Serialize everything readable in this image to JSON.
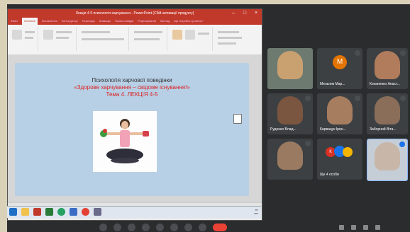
{
  "ppt": {
    "window_title": "Лекція 4-5 психологія харчування - PowerPoint (Сбій активації продукту)",
    "tabs": [
      "Файл",
      "Основне",
      "Вставлення",
      "Конструктор",
      "Переходи",
      "Анімація",
      "Показ слайдів",
      "Рецензування",
      "Вигляд",
      "Що потрібно зробити?"
    ],
    "slide": {
      "line1": "Психологія харчової поведінки",
      "line2": "«Здорове харчування – свідоме існування!»",
      "line3": "Тема 4. ЛЕКЦІЯ 4-5"
    }
  },
  "participants": [
    {
      "name": "",
      "face_color": "#c9a070",
      "bg": "#6d7a70"
    },
    {
      "name": "Мельник Мар...",
      "avatar_letter": "М",
      "avatar_color": "#e37400"
    },
    {
      "name": "Коханенко Анаст...",
      "face_color": "#b07c5c",
      "bg": "#8a8a88"
    },
    {
      "name": "Руденко Влад...",
      "face_color": "#7a5540",
      "bg": "#5a4c40"
    },
    {
      "name": "Карвацук Ірин...",
      "face_color": "#a77d60",
      "bg": "#8a6d56"
    },
    {
      "name": "Заборний Віта...",
      "face_color": "#8a6e5a",
      "bg": "#6a6a66"
    },
    {
      "name": "",
      "face_color": "#9a7a60",
      "bg": "#a5a39a"
    },
    {
      "name": "Ще 4 особи",
      "group": true
    },
    {
      "name": "",
      "face_color": "#c8b7a8",
      "bg": "#c5ced6",
      "active": true
    }
  ],
  "colors": {
    "ppt_red": "#c0392b",
    "slide_bg": "#b7d0e6",
    "meet_end": "#ea4335"
  }
}
